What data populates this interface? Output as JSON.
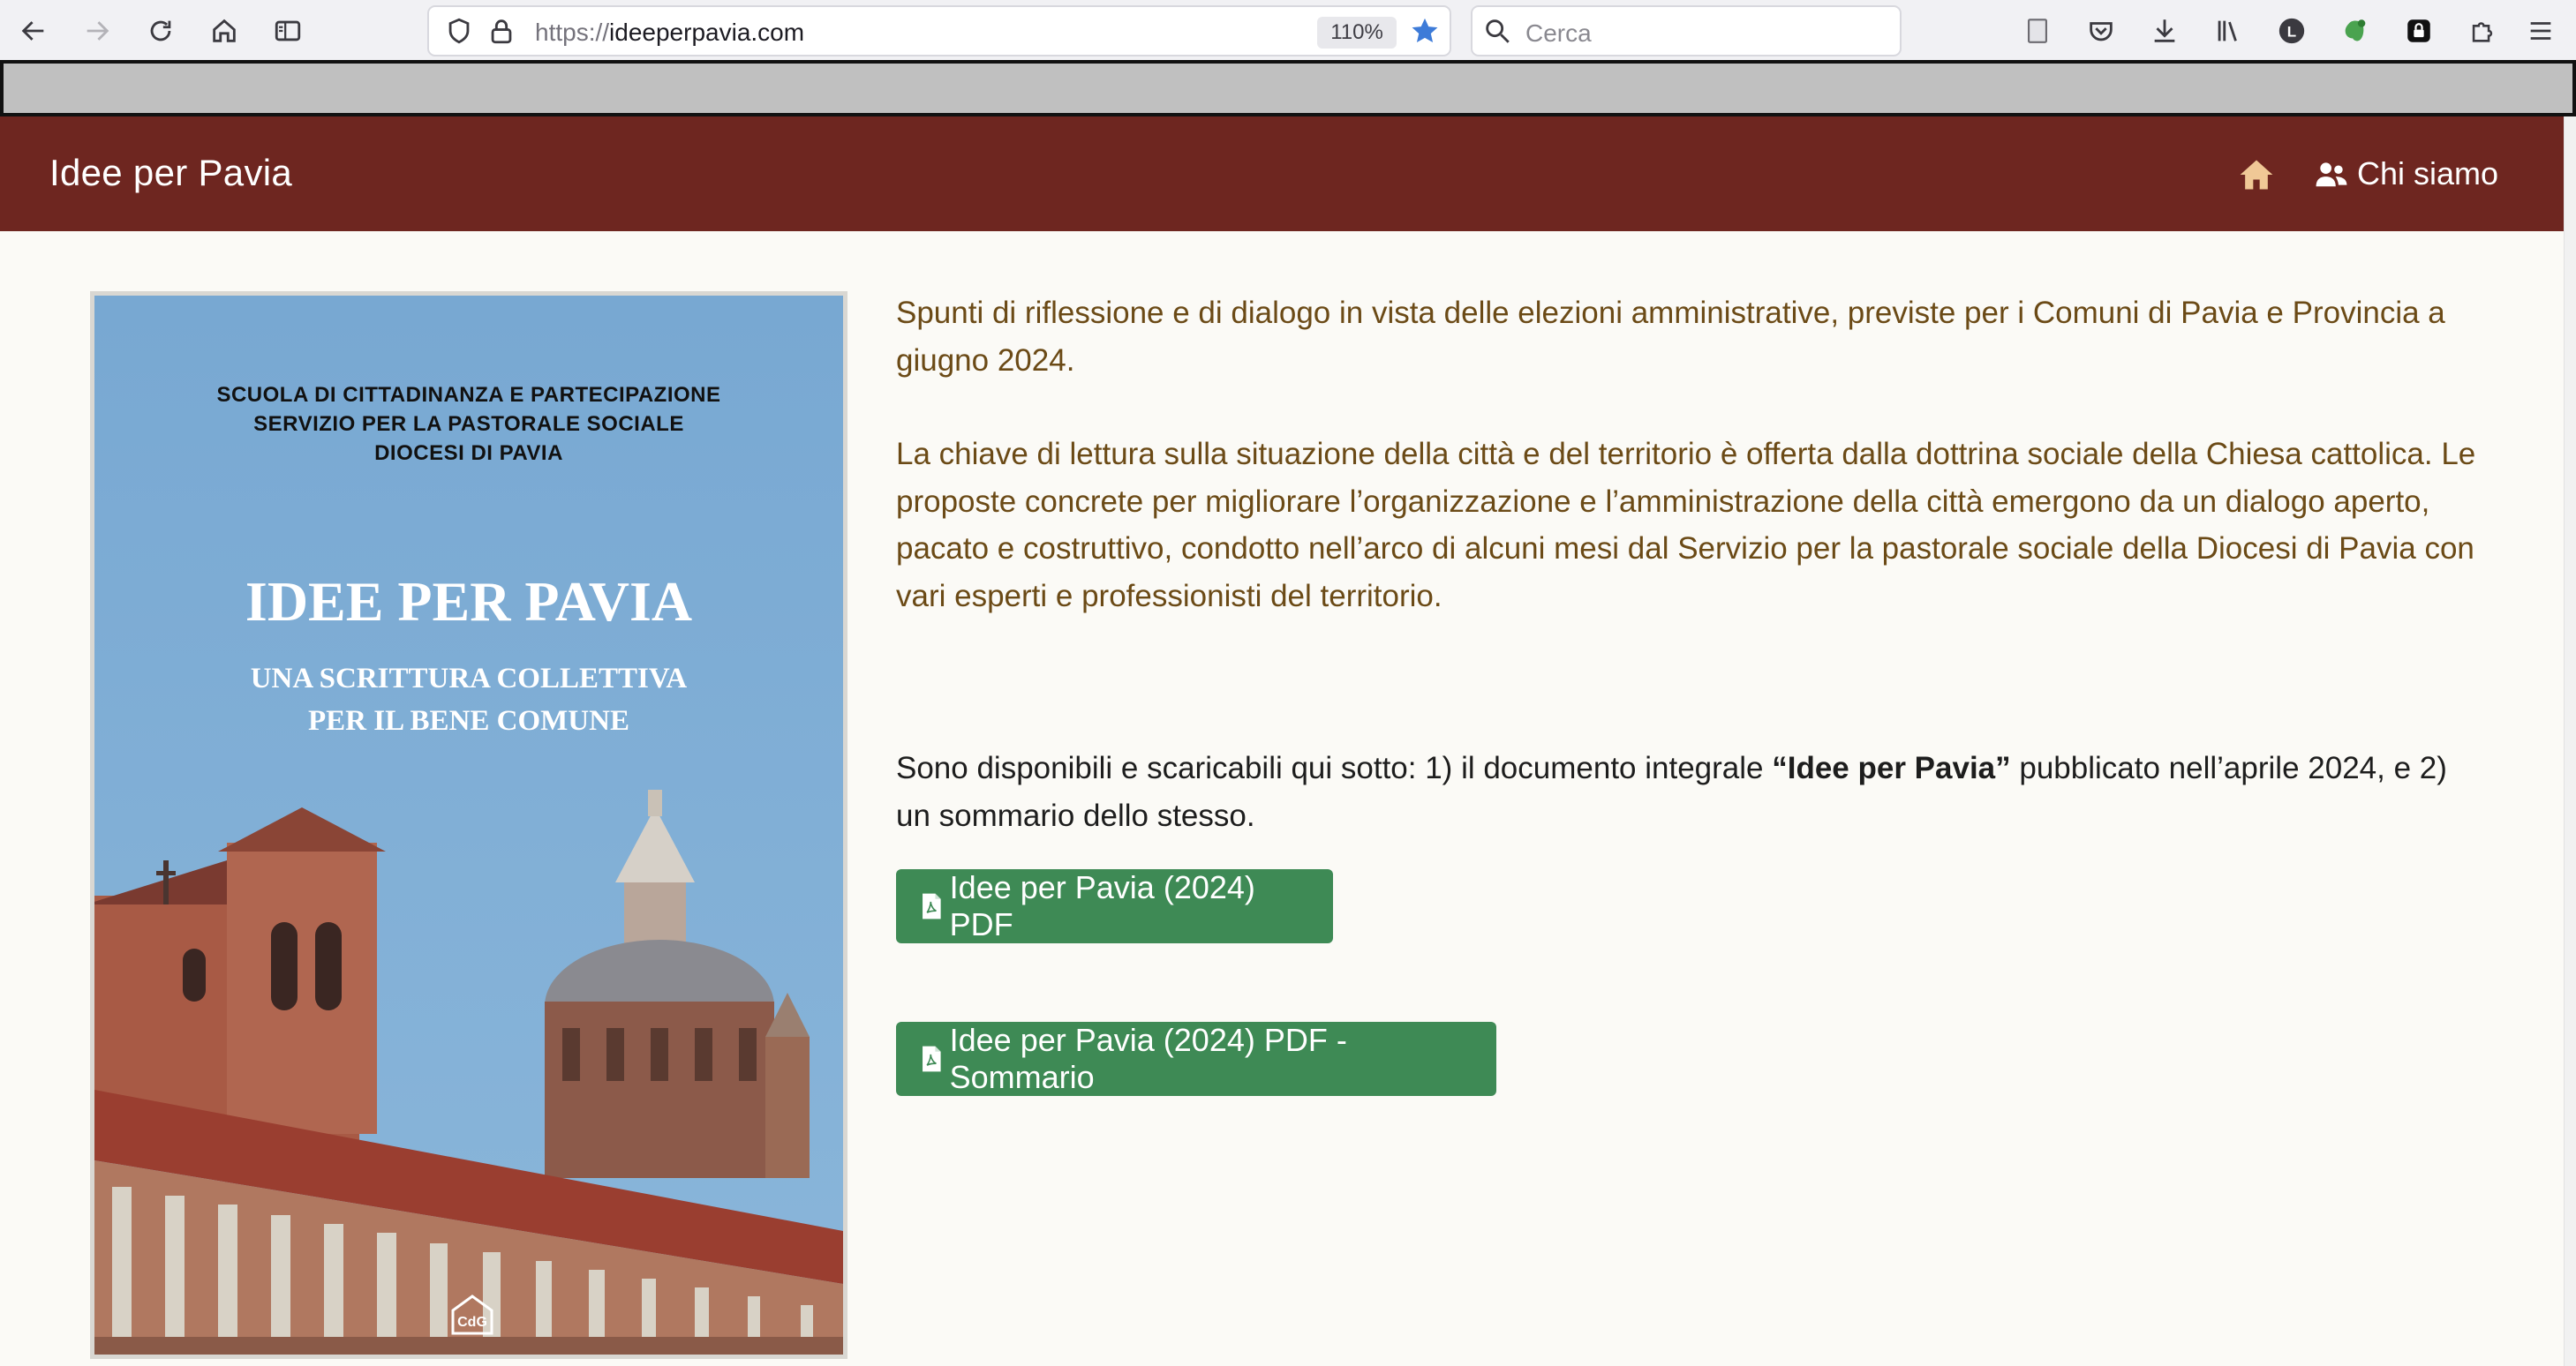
{
  "browser": {
    "url_scheme": "https://",
    "url_host": "ideeperpavia.com",
    "zoom": "110%",
    "search_placeholder": "Cerca",
    "account_initial": "L"
  },
  "site": {
    "brand": "Idee per Pavia",
    "nav_about": "Chi siamo",
    "header_color": "#6e2620",
    "accent_text_color": "#6b4a16",
    "button_color": "#3e8a55"
  },
  "cover": {
    "org_lines": [
      "SCUOLA DI CITTADINANZA E PARTECIPAZIONE",
      "SERVIZIO PER LA PASTORALE SOCIALE",
      "DIOCESI DI PAVIA"
    ],
    "title": "IDEE PER PAVIA",
    "subtitle_lines": [
      "UNA SCRITTURA COLLETTIVA",
      "PER IL BENE COMUNE"
    ],
    "logo_text": "CdG"
  },
  "content": {
    "intro_1": "Spunti di riflessione e di dialogo in vista delle elezioni amministrative, previste per i Comuni di Pavia e Provincia a giugno 2024.",
    "intro_2": "La chiave di lettura sulla situazione della città e del territorio è offerta dalla dottrina sociale della Chiesa cattolica. Le proposte concrete per migliorare l’organizzazione e l’amministrazione della città emergono da un dialogo aperto, pacato e costruttivo, condotto nell’arco di alcuni mesi dal Servizio per la pastorale sociale della Diocesi di Pavia con vari esperti e professionisti del territorio.",
    "download_prefix": "Sono disponibili e scaricabili qui sotto: 1) il documento integrale ",
    "download_bold": "“Idee per Pavia”",
    "download_suffix": " pubblicato nell’aprile 2024, e 2) un sommario dello stesso.",
    "button_full": "Idee per Pavia (2024) PDF",
    "button_summary": "Idee per Pavia (2024) PDF - Sommario"
  }
}
